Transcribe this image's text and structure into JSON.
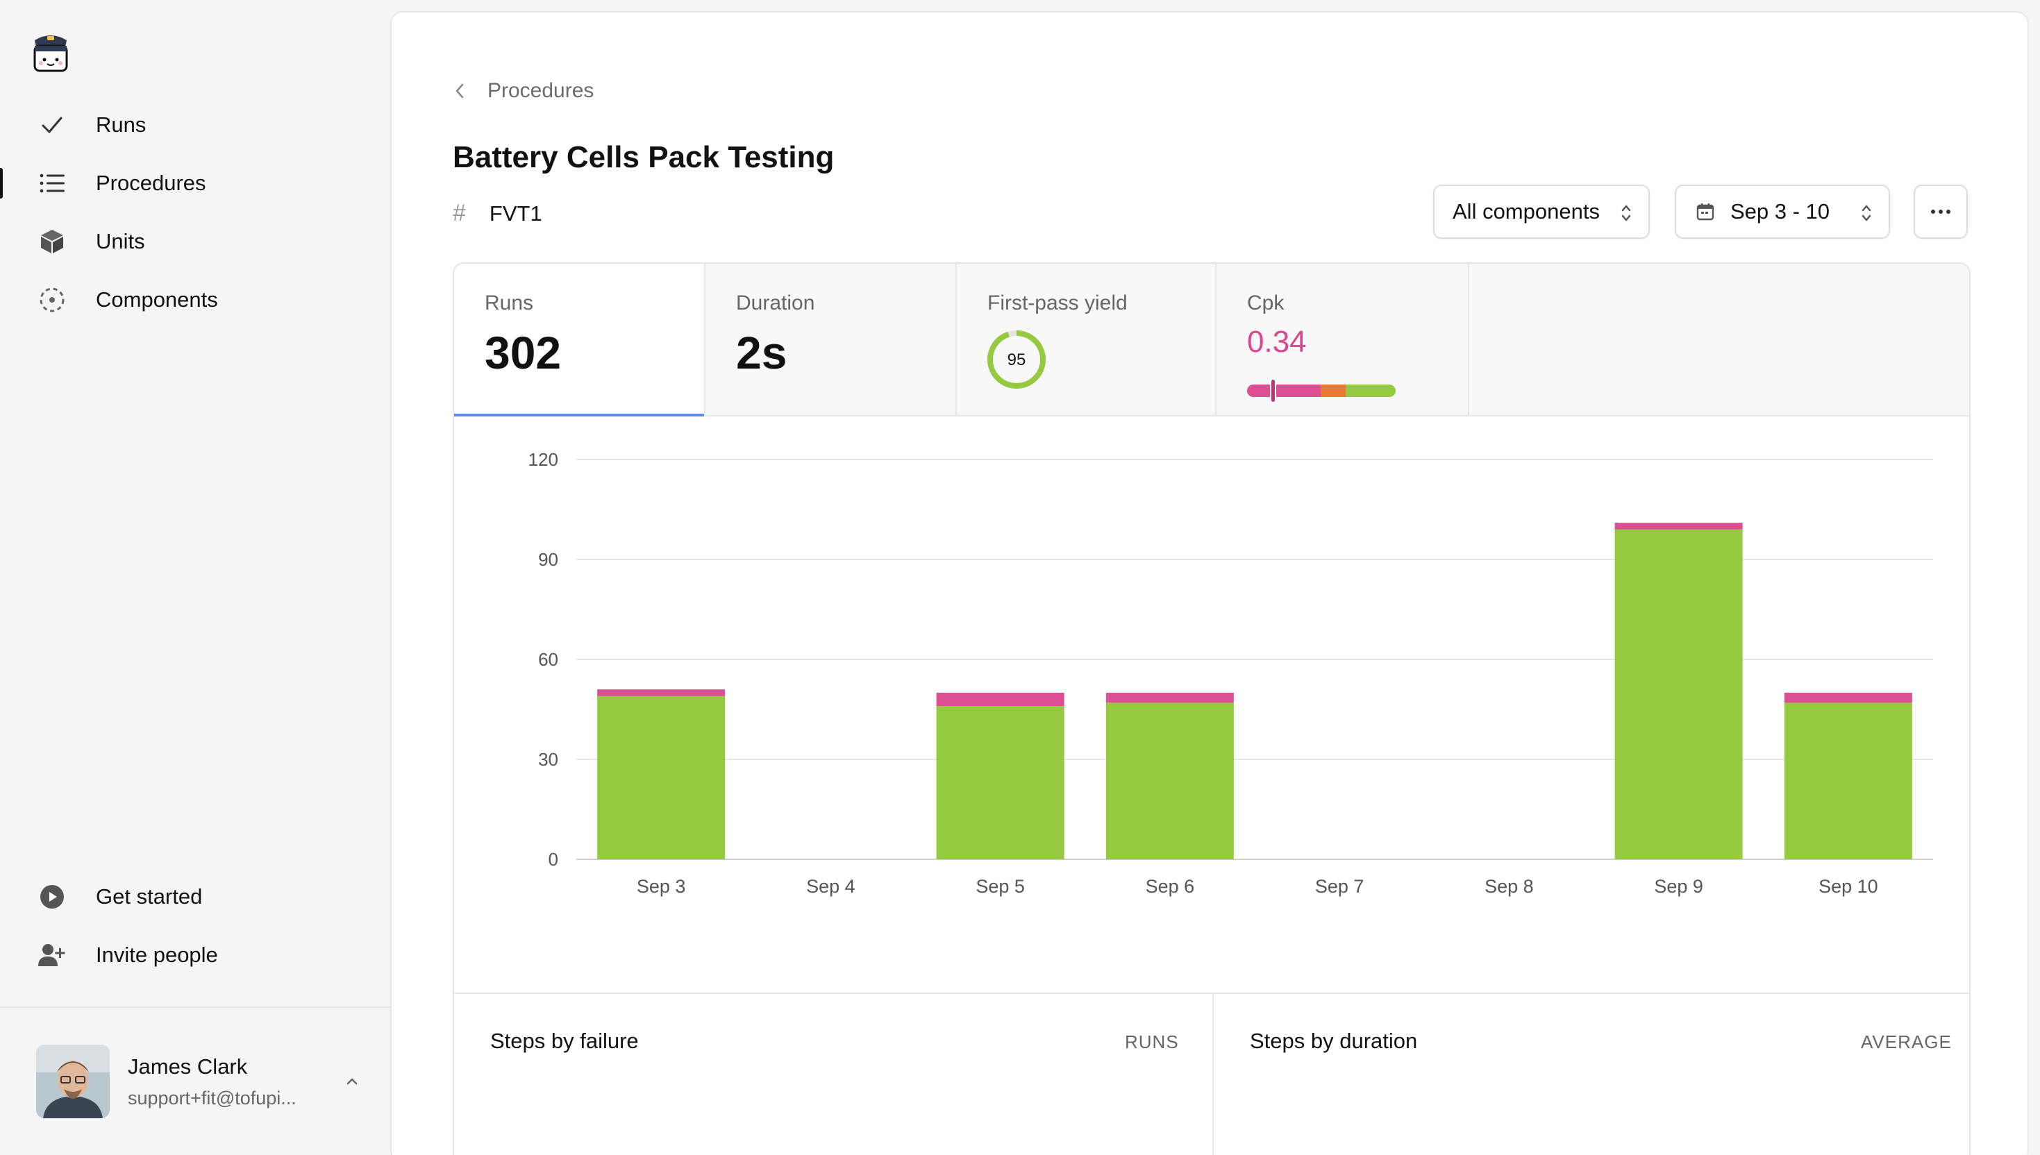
{
  "sidebar": {
    "nav": [
      {
        "label": "Runs",
        "icon": "check-icon"
      },
      {
        "label": "Procedures",
        "icon": "list-icon"
      },
      {
        "label": "Units",
        "icon": "cube-icon"
      },
      {
        "label": "Components",
        "icon": "components-icon"
      }
    ],
    "bottom": [
      {
        "label": "Get started",
        "icon": "play-circle-icon"
      },
      {
        "label": "Invite people",
        "icon": "user-plus-icon"
      }
    ],
    "user": {
      "name": "James Clark",
      "email": "support+fit@tofupi..."
    }
  },
  "header": {
    "breadcrumb": "Procedures",
    "title": "Battery Cells Pack Testing",
    "id": "FVT1",
    "components_filter": "All components",
    "date_range": "Sep 3 - 10"
  },
  "stats": {
    "runs": {
      "label": "Runs",
      "value": "302"
    },
    "duration": {
      "label": "Duration",
      "value": "2s"
    },
    "first_pass_yield": {
      "label": "First-pass yield",
      "value": "95",
      "percent": 95
    },
    "cpk": {
      "label": "Cpk",
      "value": "0.34"
    }
  },
  "chart_data": {
    "type": "bar",
    "stacked": true,
    "categories": [
      "Sep 3",
      "Sep 4",
      "Sep 5",
      "Sep 6",
      "Sep 7",
      "Sep 8",
      "Sep 9",
      "Sep 10"
    ],
    "series": [
      {
        "values": [
          49,
          0,
          46,
          47,
          0,
          0,
          99,
          47
        ],
        "color": "#95c940"
      },
      {
        "values": [
          2,
          0,
          4,
          3,
          0,
          0,
          2,
          3
        ],
        "color": "#dd4f93"
      }
    ],
    "ylim": [
      0,
      120
    ],
    "yticks": [
      0,
      30,
      60,
      90,
      120
    ],
    "grid": true
  },
  "sections": {
    "left": {
      "title": "Steps by failure",
      "meta": "RUNS"
    },
    "right": {
      "title": "Steps by duration",
      "meta": "AVERAGE"
    }
  },
  "colors": {
    "pass": "#95c940",
    "fail": "#dd4f93",
    "accent": "#5b8de8",
    "cpk": "#d9488f",
    "warn": "#ea7a35"
  }
}
